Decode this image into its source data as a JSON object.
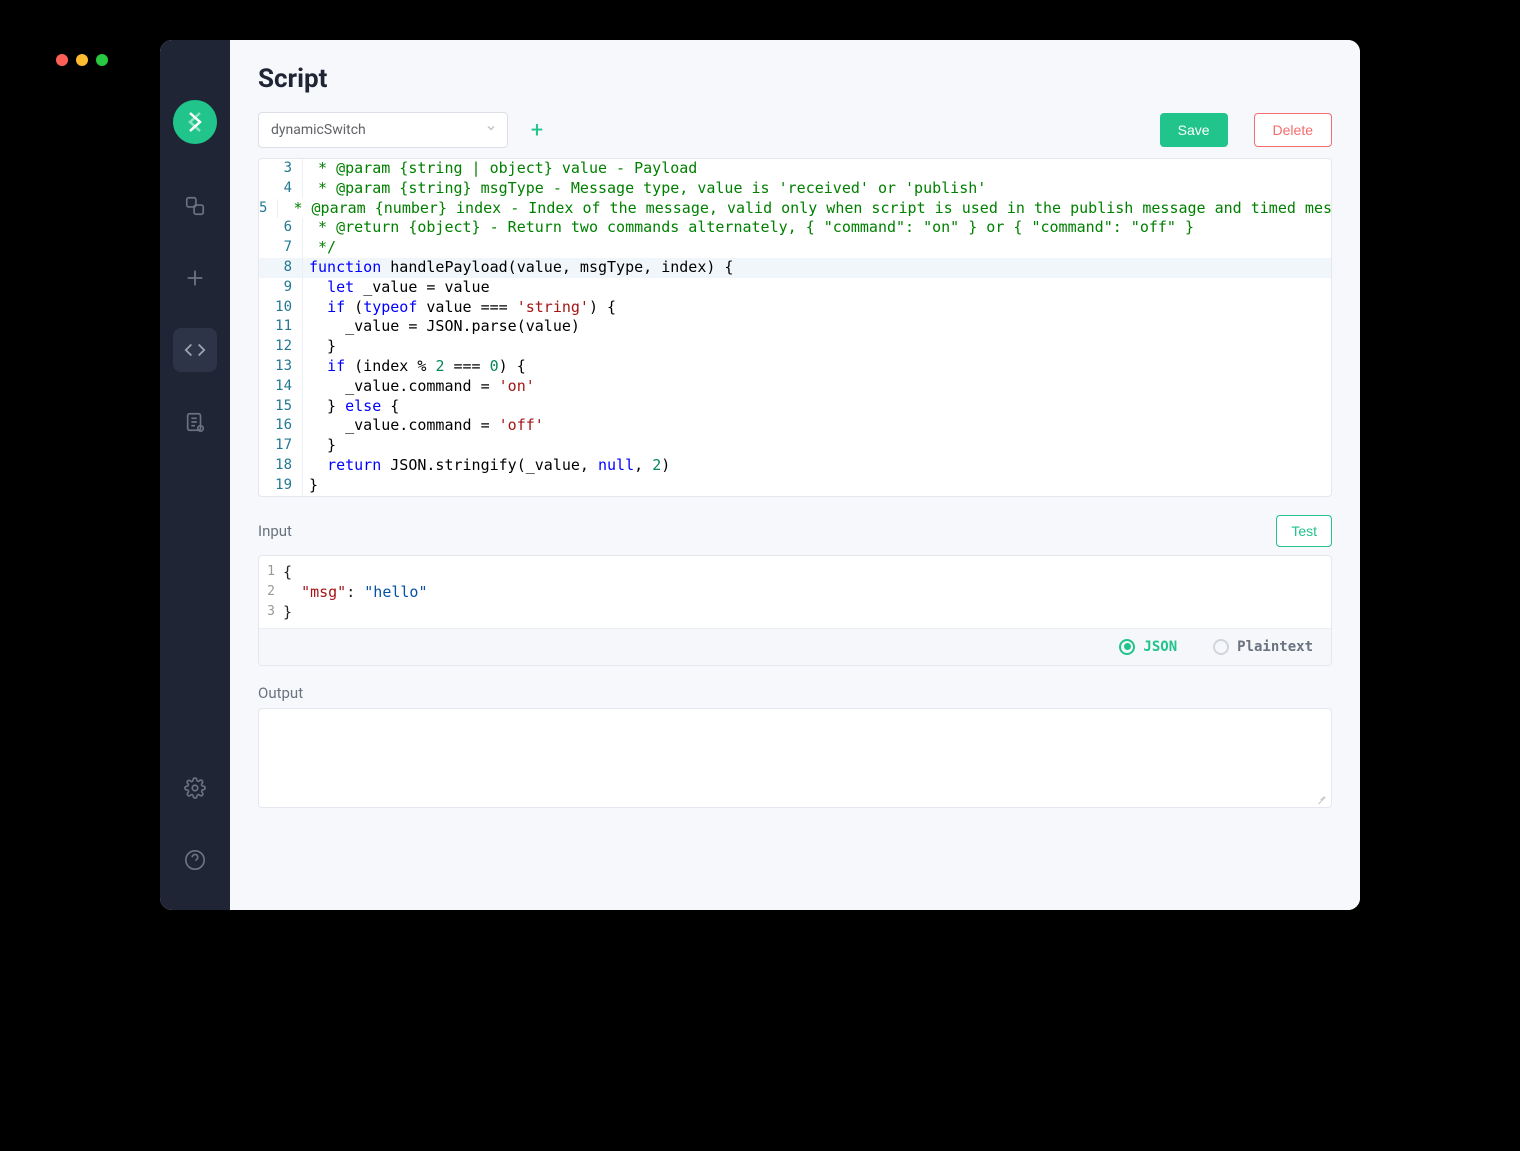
{
  "title": "Script",
  "dropdown": "dynamicSwitch",
  "buttons": {
    "save": "Save",
    "delete": "Delete",
    "test": "Test"
  },
  "section": {
    "input": "Input",
    "output": "Output"
  },
  "radios": {
    "json": "JSON",
    "plaintext": "Plaintext"
  },
  "editor": {
    "first_line": 3,
    "current_line": 8,
    "lines": [
      {
        "n": 3,
        "type": "cm",
        "t": " * @param {string | object} value - Payload"
      },
      {
        "n": 4,
        "type": "cm",
        "t": " * @param {string} msgType - Message type, value is 'received' or 'publish'"
      },
      {
        "n": 5,
        "type": "cm",
        "t": " * @param {number} index - Index of the message, valid only when script is used in the publish message and timed message"
      },
      {
        "n": 6,
        "type": "cm",
        "t": " * @return {object} - Return two commands alternately, { \"command\": \"on\" } or { \"command\": \"off\" }"
      },
      {
        "n": 7,
        "type": "cm",
        "t": " */"
      },
      {
        "n": 8,
        "tokens": [
          {
            "t": "function ",
            "c": "kw"
          },
          {
            "t": "handlePayload(value, msgType, index) {",
            "c": "fn"
          }
        ]
      },
      {
        "n": 9,
        "tokens": [
          {
            "t": "  ",
            "c": "fn"
          },
          {
            "t": "let ",
            "c": "kw"
          },
          {
            "t": "_value = value",
            "c": "fn"
          }
        ]
      },
      {
        "n": 10,
        "tokens": [
          {
            "t": "  ",
            "c": "fn"
          },
          {
            "t": "if ",
            "c": "kw"
          },
          {
            "t": "(",
            "c": "fn"
          },
          {
            "t": "typeof ",
            "c": "kw"
          },
          {
            "t": "value === ",
            "c": "fn"
          },
          {
            "t": "'string'",
            "c": "str"
          },
          {
            "t": ") {",
            "c": "fn"
          }
        ]
      },
      {
        "n": 11,
        "tokens": [
          {
            "t": "    _value = JSON.parse(value)",
            "c": "fn"
          }
        ]
      },
      {
        "n": 12,
        "tokens": [
          {
            "t": "  }",
            "c": "fn"
          }
        ]
      },
      {
        "n": 13,
        "tokens": [
          {
            "t": "  ",
            "c": "fn"
          },
          {
            "t": "if ",
            "c": "kw"
          },
          {
            "t": "(index % ",
            "c": "fn"
          },
          {
            "t": "2",
            "c": "num"
          },
          {
            "t": " === ",
            "c": "fn"
          },
          {
            "t": "0",
            "c": "num"
          },
          {
            "t": ") {",
            "c": "fn"
          }
        ]
      },
      {
        "n": 14,
        "tokens": [
          {
            "t": "    _value.command = ",
            "c": "fn"
          },
          {
            "t": "'on'",
            "c": "str"
          }
        ]
      },
      {
        "n": 15,
        "tokens": [
          {
            "t": "  } ",
            "c": "fn"
          },
          {
            "t": "else ",
            "c": "kw"
          },
          {
            "t": "{",
            "c": "fn"
          }
        ]
      },
      {
        "n": 16,
        "tokens": [
          {
            "t": "    _value.command = ",
            "c": "fn"
          },
          {
            "t": "'off'",
            "c": "str"
          }
        ]
      },
      {
        "n": 17,
        "tokens": [
          {
            "t": "  }",
            "c": "fn"
          }
        ]
      },
      {
        "n": 18,
        "tokens": [
          {
            "t": "  ",
            "c": "fn"
          },
          {
            "t": "return ",
            "c": "kw"
          },
          {
            "t": "JSON.stringify(_value, ",
            "c": "fn"
          },
          {
            "t": "null",
            "c": "kw"
          },
          {
            "t": ", ",
            "c": "fn"
          },
          {
            "t": "2",
            "c": "num"
          },
          {
            "t": ")",
            "c": "fn"
          }
        ]
      },
      {
        "n": 19,
        "tokens": [
          {
            "t": "}",
            "c": "fn"
          }
        ]
      }
    ]
  },
  "input_json": {
    "lines": [
      {
        "n": 1,
        "tokens": [
          {
            "t": "{",
            "c": ""
          }
        ]
      },
      {
        "n": 2,
        "tokens": [
          {
            "t": "  ",
            "c": ""
          },
          {
            "t": "\"msg\"",
            "c": "key"
          },
          {
            "t": ": ",
            "c": ""
          },
          {
            "t": "\"hello\"",
            "c": "val"
          }
        ]
      },
      {
        "n": 3,
        "tokens": [
          {
            "t": "}",
            "c": ""
          }
        ]
      }
    ]
  }
}
